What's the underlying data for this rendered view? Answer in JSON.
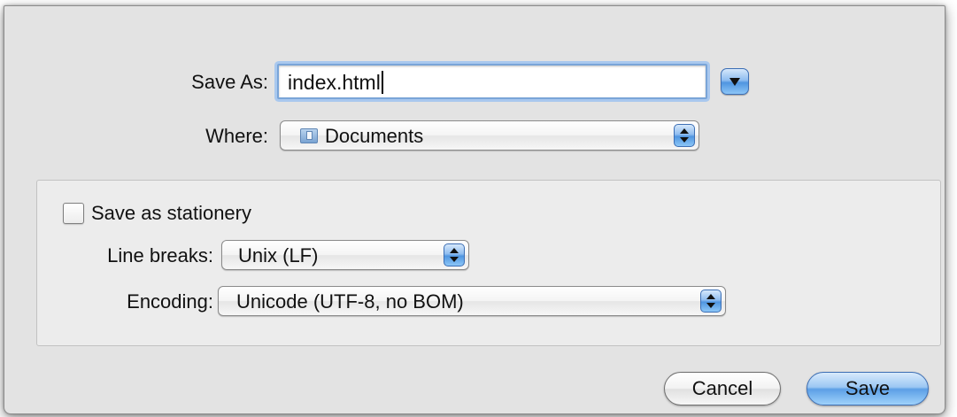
{
  "dialog": {
    "save_as_label": "Save As:",
    "filename": "index.html",
    "where_label": "Where:",
    "where_value": "Documents",
    "options": {
      "stationery_label": "Save as stationery",
      "stationery_checked": false,
      "line_breaks_label": "Line breaks:",
      "line_breaks_value": "Unix (LF)",
      "encoding_label": "Encoding:",
      "encoding_value": "Unicode (UTF-8, no BOM)"
    },
    "buttons": {
      "cancel": "Cancel",
      "save": "Save"
    }
  },
  "icons": {
    "disclosure": "chevron-down-icon",
    "where": "folder-icon",
    "popup_arrows": "up-down-arrows-icon"
  },
  "colors": {
    "sheet_bg": "#e3e3e3",
    "options_bg": "#ececec",
    "accent_blue": "#5c9fe6",
    "focus_ring": "#a9c8ee"
  }
}
